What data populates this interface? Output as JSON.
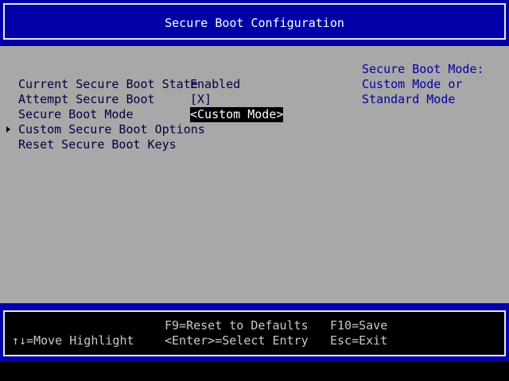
{
  "header": {
    "title": "Secure Boot Configuration"
  },
  "settings": [
    {
      "label": "Current Secure Boot State",
      "value": "Enabled"
    },
    {
      "label": "Attempt Secure Boot",
      "value": "[X]"
    },
    {
      "label": "Secure Boot Mode",
      "value": "<Custom Mode>",
      "selected": true
    }
  ],
  "submenus": [
    {
      "label": "Custom Secure Boot Options",
      "has_arrow": true
    },
    {
      "label": "Reset Secure Boot Keys"
    }
  ],
  "help": {
    "lines": [
      "Secure Boot Mode:",
      "Custom Mode or",
      "Standard Mode"
    ]
  },
  "footer": {
    "nav_hint": "↑↓=Move Highlight",
    "f9": "F9=Reset to Defaults",
    "enter": "<Enter>=Select Entry",
    "f10": "F10=Save",
    "esc": "Esc=Exit"
  },
  "colors": {
    "bios_blue": "#0000a8",
    "panel_gray": "#a8a8a8",
    "help_text": "#0000a8",
    "selection_bg": "#000000",
    "selection_fg": "#ffffff"
  }
}
